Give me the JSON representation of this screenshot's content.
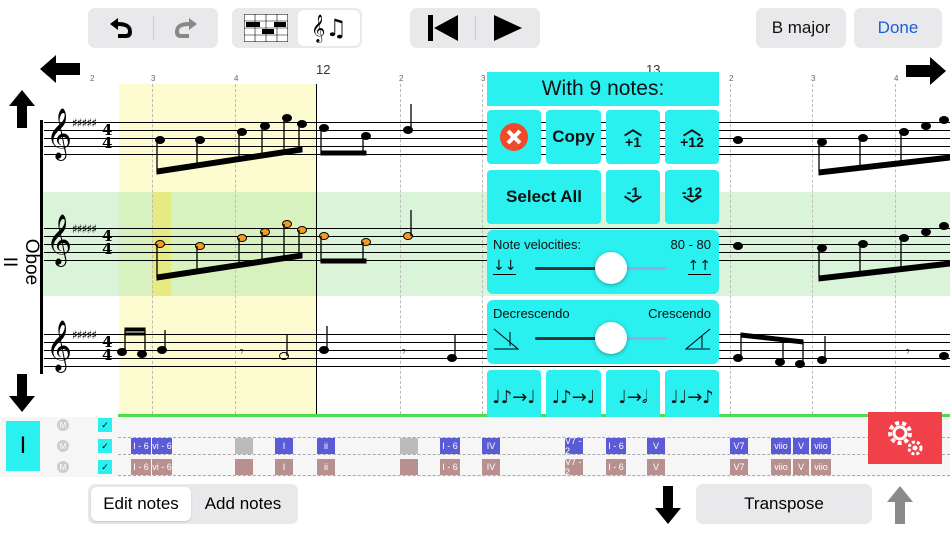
{
  "toolbar": {
    "undo_icon": "undo-arrow-icon",
    "redo_icon": "redo-arrow-icon",
    "key_label": "B major",
    "done_label": "Done"
  },
  "ruler": {
    "measure_12": "12",
    "measure_13": "13",
    "ticks": [
      "2",
      "3",
      "4",
      "2",
      "3",
      "4",
      "2",
      "3",
      "4"
    ]
  },
  "instrument": {
    "name": "Oboe II"
  },
  "popup": {
    "title": "With 9 notes:",
    "copy_label": "Copy",
    "up1_label": "+1",
    "up12_label": "+12",
    "select_all_label": "Select All",
    "down1_label": "-1",
    "down12_label": "-12",
    "velocity_label": "Note velocities:",
    "velocity_value": "80 - 80",
    "decrescendo_label": "Decrescendo",
    "crescendo_label": "Crescendo"
  },
  "sidebar": {
    "track_label": "I",
    "mute_labels": [
      "M",
      "M",
      "M"
    ]
  },
  "chords": {
    "row1": [
      "I",
      "I - 6",
      "vi - 6",
      "I",
      "ii",
      "I - 6",
      "IV",
      "V7 - 2",
      "I - 6",
      "V",
      "V7",
      "viio",
      "V",
      "viio"
    ],
    "row2": [
      "I - 6",
      "vi - 6",
      "I",
      "ii",
      "I - 6",
      "IV",
      "V7 - 2",
      "I - 6",
      "V",
      "V7",
      "viio",
      "V",
      "viio"
    ]
  },
  "bottom": {
    "edit_notes": "Edit notes",
    "add_notes": "Add notes",
    "transpose": "Transpose"
  },
  "colors": {
    "accent_cyan": "#2af0f0",
    "selection_yellow": "#fdfbd0",
    "row_green": "#d8f3d8",
    "settings_red": "#f0414a",
    "chord_blue": "#5b5bd6"
  }
}
